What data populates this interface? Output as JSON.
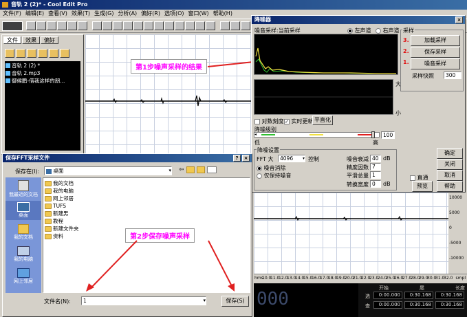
{
  "main_window": {
    "title": "音轨  2 (2)* - Cool Edit Pro",
    "menu": [
      "文件(F)",
      "编辑(E)",
      "查看(V)",
      "效果(T)",
      "生成(G)",
      "分析(A)",
      "偏好(R)",
      "选项(O)",
      "窗口(W)",
      "帮助(H)"
    ],
    "left_tabs": [
      "文件",
      "效果",
      "偏好"
    ],
    "files": [
      "音轨  2 (2) *",
      "音轨  2.mp3",
      "御候鹏-借我这样的朋..."
    ],
    "bottom_time": "000"
  },
  "noise_dialog": {
    "title": "降噪器",
    "profile_label": "噪音采样:当前采样",
    "channel_left": "左声道",
    "channel_right": "右声道",
    "sample_group": "采样",
    "btn_load": "加载采样",
    "btn_save": "保存采样",
    "btn_capture": "噪音采样",
    "snapshot_label": "采样快照",
    "snapshot_value": "300",
    "step_numbers": [
      "3.",
      "2.",
      "1."
    ],
    "label_big": "大",
    "label_small": "小",
    "log_scale": "对数刻度",
    "live_update": "实时更新",
    "flatten": "平直化",
    "reduction_level": "降噪级别",
    "low": "低",
    "high": "高",
    "level_value": "100",
    "settings_group": "降噪设置",
    "fft_label": "FFT 大",
    "fft_value": "4096",
    "control_label": "控制",
    "remove_noise": "噪音消除",
    "keep_noise": "仅保持噪音",
    "attenuation_label": "噪音衰减",
    "attenuation_value": "40",
    "attenuation_unit": "dB",
    "precision_label": "精度因数",
    "precision_value": "7",
    "smoothing_label": "平滑总量",
    "smoothing_value": "1",
    "transition_label": "转换宽度",
    "transition_value": "0",
    "transition_unit": "dB",
    "bypass": "直通",
    "btn_ok": "确定",
    "btn_close": "关闭",
    "btn_cancel": "取消",
    "btn_preview": "预览",
    "btn_help": "帮助"
  },
  "save_dialog": {
    "title": "保存FFT采样文件",
    "save_in_label": "保存在(I):",
    "save_in_value": "桌面",
    "places": [
      "我最近的文档",
      "桌面",
      "我的文档",
      "我的电脑",
      "网上邻居"
    ],
    "items": [
      "我的文档",
      "我的电脑",
      "网上邻居",
      "TUFS",
      "新建男",
      "教程",
      "新建文件夹",
      "资料"
    ],
    "filename_label": "文件名(N):",
    "filename_value": "1",
    "save_button": "保存(S)"
  },
  "annotations": {
    "step1": "第1步噪声采样的结果",
    "step2": "第2步保存噪声采样"
  },
  "ruler": {
    "ticks": [
      "10.0",
      "11.0",
      "12.0",
      "13.0",
      "14.0",
      "15.0",
      "16.0",
      "17.0",
      "18.0",
      "19.0",
      "20.0",
      "21.0",
      "22.0",
      "23.0",
      "24.0",
      "25.0",
      "26.0",
      "27.0",
      "28.0",
      "29.0",
      "30.0",
      "31.0",
      "32.0"
    ],
    "db_labels": [
      "10000",
      "5000",
      "0",
      "-5000",
      "-10000"
    ],
    "hms": "hms",
    "smpl": "smpl"
  },
  "time_panel": {
    "headers": [
      "开始",
      "尾",
      "长度"
    ],
    "row_labels": [
      "选",
      "查"
    ],
    "values": [
      [
        "0:00.000",
        "0:30.168",
        "0:30.168"
      ],
      [
        "0:00.000",
        "0:30.168",
        "0:30.168"
      ]
    ]
  }
}
